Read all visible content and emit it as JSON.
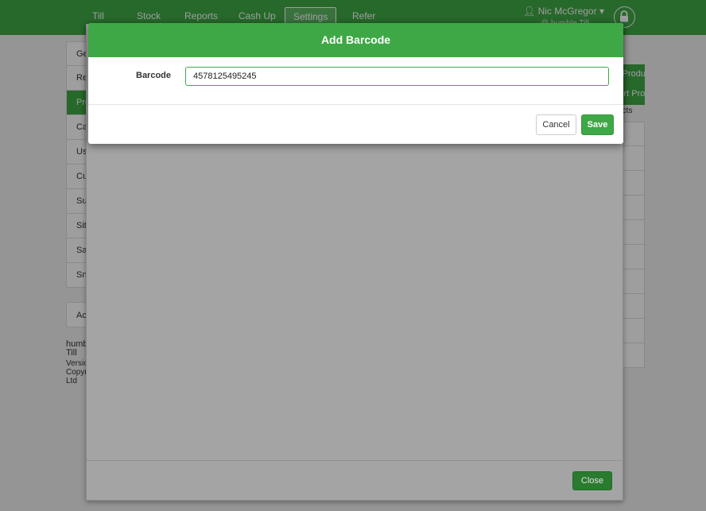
{
  "nav": {
    "items": [
      {
        "label": "Till",
        "active": false
      },
      {
        "label": "Stock",
        "active": false
      },
      {
        "label": "Reports",
        "active": false
      },
      {
        "label": "Cash Up",
        "active": false
      },
      {
        "label": "Settings",
        "active": true
      },
      {
        "label": "Refer",
        "active": false
      }
    ],
    "user_name": "Nic McGregor",
    "user_sub": "@ humble Till",
    "icons": {
      "user": "user-icon",
      "dropdown": "caret-down-icon",
      "lock": "lock-icon"
    }
  },
  "sidebar": {
    "items": [
      {
        "label": "General",
        "active": false
      },
      {
        "label": "Receipts",
        "active": false
      },
      {
        "label": "Products",
        "active": true
      },
      {
        "label": "Categories",
        "active": false
      },
      {
        "label": "Users",
        "active": false
      },
      {
        "label": "Customers",
        "active": false
      },
      {
        "label": "Suppliers",
        "active": false
      },
      {
        "label": "Sites",
        "active": false
      },
      {
        "label": "Sage",
        "active": false
      },
      {
        "label": "Snapshots",
        "active": false
      }
    ],
    "extra": "Account",
    "footer": {
      "title": "humble Till",
      "version": "Version",
      "copyright": "Copyright",
      "company": "Ltd"
    }
  },
  "right_panel": {
    "button_line1": "Add Product",
    "button_line2": "Import Products",
    "label": "Products"
  },
  "outer_modal": {
    "close_label": "Close"
  },
  "barcode_modal": {
    "title": "Add Barcode",
    "field_label": "Barcode",
    "value": "4578125495245",
    "cancel_label": "Cancel",
    "save_label": "Save"
  },
  "colors": {
    "brand_green": "#3fa846",
    "close_green": "#2a7b2f"
  }
}
